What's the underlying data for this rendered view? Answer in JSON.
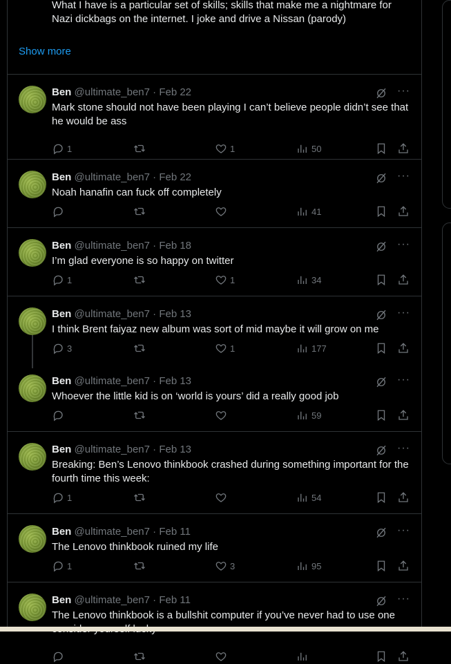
{
  "profile": {
    "bio_line1": "What I have is a particular set of skills; skills that make me a nightmare for",
    "bio_line2": "Nazi dickbags on the internet. I joke and drive a Nissan (parody)",
    "show_more": "Show more"
  },
  "tweets": [
    {
      "name": "Ben",
      "handle": "@ultimate_ben7",
      "date": "· Feb 22",
      "text": "Mark stone should not have been playing I can’t believe people didn’t see that he would be ass",
      "replies": "1",
      "retweets": "",
      "likes": "1",
      "views": "50"
    },
    {
      "name": "Ben",
      "handle": "@ultimate_ben7",
      "date": "· Feb 22",
      "text": "Noah hanafin can fuck off completely",
      "replies": "",
      "retweets": "",
      "likes": "",
      "views": "41"
    },
    {
      "name": "Ben",
      "handle": "@ultimate_ben7",
      "date": "· Feb 18",
      "text": "I’m glad everyone is so happy on twitter",
      "replies": "1",
      "retweets": "",
      "likes": "1",
      "views": "34"
    },
    {
      "name": "Ben",
      "handle": "@ultimate_ben7",
      "date": "· Feb 13",
      "text": "I think Brent faiyaz new album was sort of mid maybe it will grow on me",
      "replies": "3",
      "retweets": "",
      "likes": "1",
      "views": "177"
    },
    {
      "name": "Ben",
      "handle": "@ultimate_ben7",
      "date": "· Feb 13",
      "text": "Whoever the little kid is on ‘world is yours’ did a really good job",
      "replies": "",
      "retweets": "",
      "likes": "",
      "views": "59"
    },
    {
      "name": "Ben",
      "handle": "@ultimate_ben7",
      "date": "· Feb 13",
      "text": "Breaking: Ben’s Lenovo thinkbook crashed during something important for the fourth time this week:",
      "replies": "1",
      "retweets": "",
      "likes": "",
      "views": "54"
    },
    {
      "name": "Ben",
      "handle": "@ultimate_ben7",
      "date": "· Feb 11",
      "text": "The Lenovo thinkbook ruined my life",
      "replies": "1",
      "retweets": "",
      "likes": "3",
      "views": "95"
    },
    {
      "name": "Ben",
      "handle": "@ultimate_ben7",
      "date": "· Feb 11",
      "text": "The Lenovo thinkbook is a bullshit computer if you’ve never had to use one consider yourself lucky",
      "replies": "",
      "retweets": "",
      "likes": "",
      "views": ""
    }
  ],
  "colors": {
    "accent": "#1d9bf0",
    "muted": "#71767b",
    "border": "#2f3336"
  },
  "icons": [
    "reply-icon",
    "retweet-icon",
    "like-icon",
    "views-icon",
    "bookmark-icon",
    "share-icon",
    "grok-icon",
    "more-icon"
  ]
}
